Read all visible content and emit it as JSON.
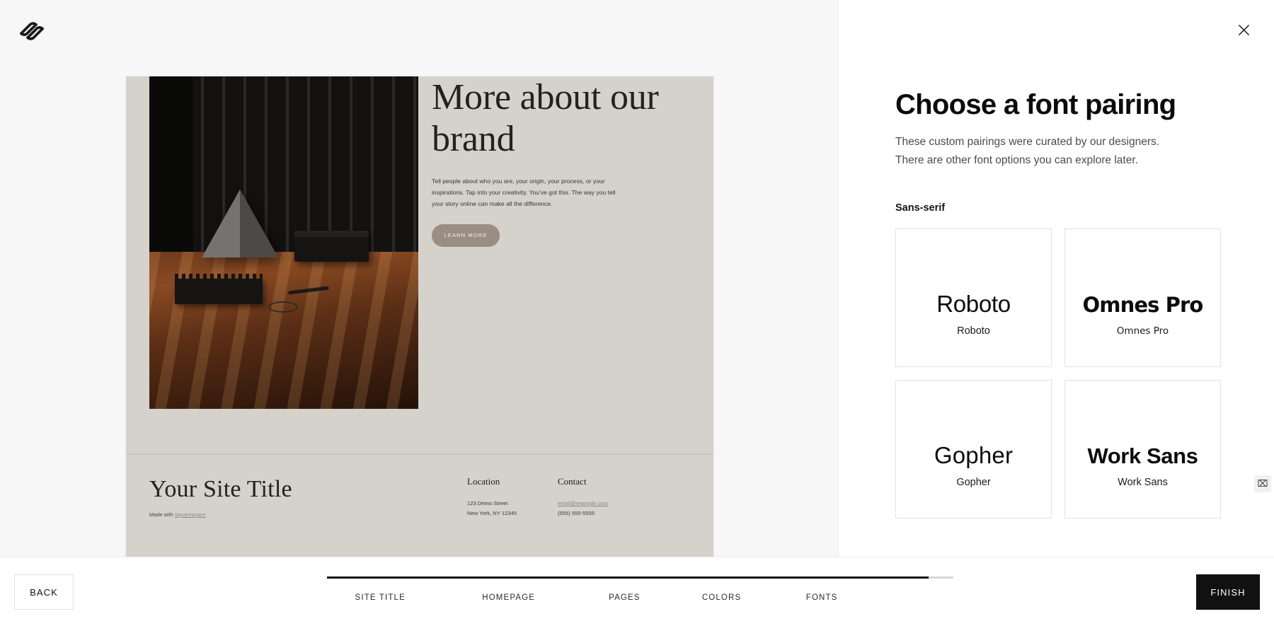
{
  "app": {
    "logo_icon": "squarespace-logo-icon",
    "close_icon": "close-icon",
    "background": "#f7f7f7",
    "accent": "#111111"
  },
  "preview": {
    "page_background": "#d5d2cb",
    "hero": {
      "title": "More about our brand",
      "body": "Tell people about who you are, your origin, your process, or  your inspirations. Tap into your creativity. You've got this. The way you tell your story online can make all the difference.",
      "button_label": "LEARN MORE",
      "button_color": "#9a8d81"
    },
    "footer": {
      "site_title": "Your Site Title",
      "made_with_prefix": "Made with ",
      "made_with_link": "Squarespace",
      "columns": [
        {
          "heading": "Location",
          "lines": [
            "123 Demo Street",
            "New York, NY 12345"
          ]
        },
        {
          "heading": "Contact",
          "lines": [
            "email@example.com",
            "(555) 555-5555"
          ]
        }
      ]
    }
  },
  "panel": {
    "title": "Choose a font pairing",
    "subtitle_line1": "These custom pairings were curated by our designers.",
    "subtitle_line2": "There are other font options you can explore later.",
    "category_label": "Sans-serif",
    "font_cards": [
      {
        "display": "Roboto",
        "body": "Roboto"
      },
      {
        "display": "Omnes Pro",
        "body": "Omnes Pro"
      },
      {
        "display": "Gopher",
        "body": "Gopher"
      },
      {
        "display": "Work Sans",
        "body": "Work Sans"
      }
    ]
  },
  "bottom": {
    "back_label": "BACK",
    "finish_label": "FINISH",
    "progress_percent": 96,
    "steps": [
      {
        "label": "SITE TITLE",
        "position_percent": 8.5
      },
      {
        "label": "HOMEPAGE",
        "position_percent": 29.0
      },
      {
        "label": "PAGES",
        "position_percent": 47.5
      },
      {
        "label": "COLORS",
        "position_percent": 63.0
      },
      {
        "label": "FONTS",
        "position_percent": 79.0
      }
    ]
  },
  "cursor": {
    "glyph": "⌧"
  }
}
